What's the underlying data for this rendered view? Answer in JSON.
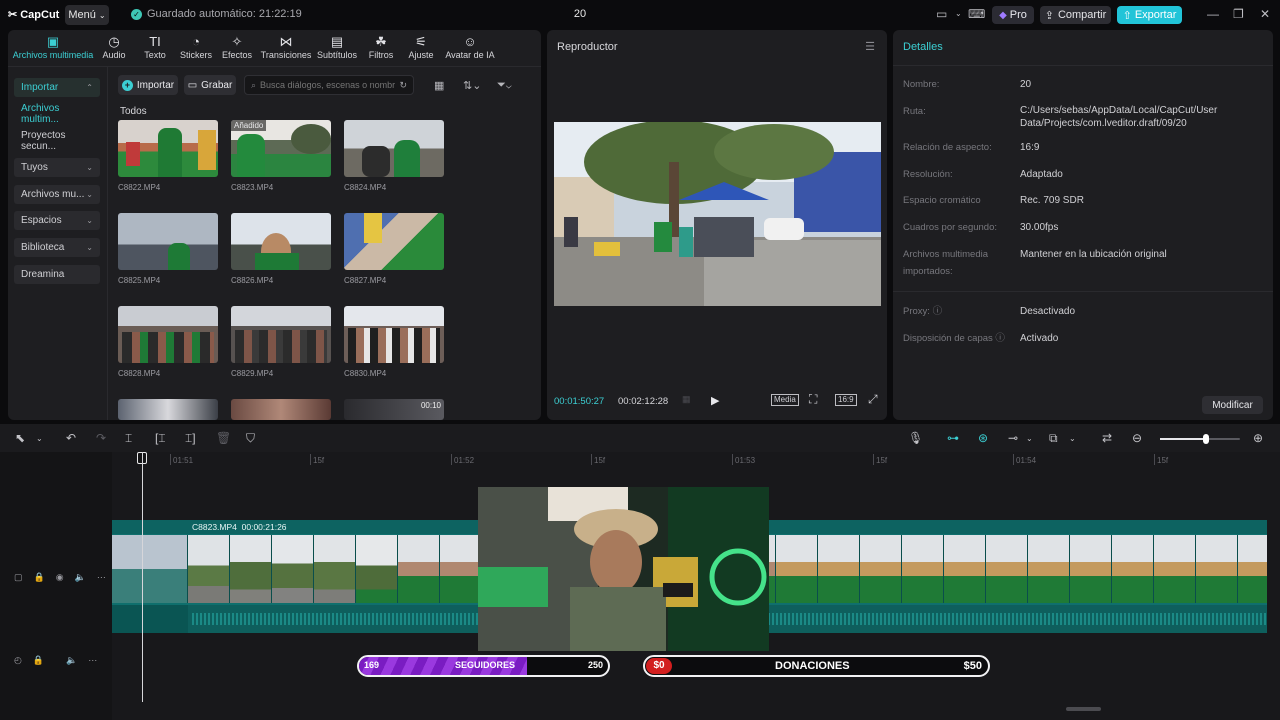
{
  "topbar": {
    "app_name": "CapCut",
    "menu_label": "Menú",
    "autosave": "Guardado automático: 21:22:19",
    "project_title": "20",
    "pro_label": "Pro",
    "share_label": "Compartir",
    "export_label": "Exportar"
  },
  "tabs": [
    {
      "label": "Archivos multimedia"
    },
    {
      "label": "Audio"
    },
    {
      "label": "Texto"
    },
    {
      "label": "Stickers"
    },
    {
      "label": "Efectos"
    },
    {
      "label": "Transiciones"
    },
    {
      "label": "Subtítulos"
    },
    {
      "label": "Filtros"
    },
    {
      "label": "Ajuste"
    },
    {
      "label": "Avatar de IA"
    }
  ],
  "sidebar": {
    "items": [
      {
        "label": "Importar"
      },
      {
        "label": "Archivos multim..."
      },
      {
        "label": "Proyectos secun..."
      },
      {
        "label": "Tuyos"
      },
      {
        "label": "Archivos mu..."
      },
      {
        "label": "Espacios"
      },
      {
        "label": "Biblioteca"
      },
      {
        "label": "Dreamina"
      }
    ]
  },
  "media": {
    "import_label": "Importar",
    "record_label": "Grabar",
    "search_placeholder": "Busca diálogos, escenas o nombre...",
    "section_label": "Todos",
    "added_badge": "Añadido",
    "clips": [
      {
        "name": "C8822.MP4",
        "duration": ""
      },
      {
        "name": "C8823.MP4",
        "duration": ""
      },
      {
        "name": "C8824.MP4",
        "duration": ""
      },
      {
        "name": "C8825.MP4",
        "duration": ""
      },
      {
        "name": "C8826.MP4",
        "duration": ""
      },
      {
        "name": "C8827.MP4",
        "duration": ""
      },
      {
        "name": "C8828.MP4",
        "duration": ""
      },
      {
        "name": "C8829.MP4",
        "duration": ""
      },
      {
        "name": "C8830.MP4",
        "duration": ""
      },
      {
        "name": "",
        "duration": ""
      },
      {
        "name": "",
        "duration": ""
      },
      {
        "name": "",
        "duration": "00:10"
      }
    ]
  },
  "player": {
    "title": "Reproductor",
    "current_time": "00:01:50:27",
    "total_time": "00:02:12:28",
    "media_label": "Media",
    "ratio_label": "16:9"
  },
  "details": {
    "title": "Detalles",
    "rows": [
      {
        "label": "Nombre:",
        "value": "20"
      },
      {
        "label": "Ruta:",
        "value": "C:/Users/sebas/AppData/Local/CapCut/User Data/Projects/com.lveditor.draft/09/20"
      },
      {
        "label": "Relación de aspecto:",
        "value": "16:9"
      },
      {
        "label": "Resolución:",
        "value": "Adaptado"
      },
      {
        "label": "Espacio cromático",
        "value": "Rec. 709 SDR"
      },
      {
        "label": "Cuadros por segundo:",
        "value": "30.00fps"
      },
      {
        "label": "Archivos multimedia importados:",
        "value": "Mantener en la ubicación original"
      },
      {
        "label": "Proxy:",
        "value": "Desactivado"
      },
      {
        "label": "Disposición de capas",
        "value": "Activado"
      }
    ],
    "modify_label": "Modificar"
  },
  "timeline": {
    "ruler": [
      "01:51",
      "15f",
      "01:52",
      "15f",
      "01:53",
      "15f",
      "01:54",
      "15f"
    ],
    "clip_name": "C8823.MP4",
    "clip_duration": "00:00:21:26"
  },
  "overlay": {
    "followers_current": "169",
    "followers_label": "SEGUIDORES",
    "followers_goal": "250",
    "followers_progress": 0.676,
    "donations_current": "$0",
    "donations_label": "DONACIONES",
    "donations_goal": "$50"
  },
  "colors": {
    "accent": "#3ccfd3",
    "export": "#21c4d8",
    "pro_gem": "#9f7bff",
    "followers_fill": "#8a2be2",
    "donation_badge": "#d21e1e"
  }
}
